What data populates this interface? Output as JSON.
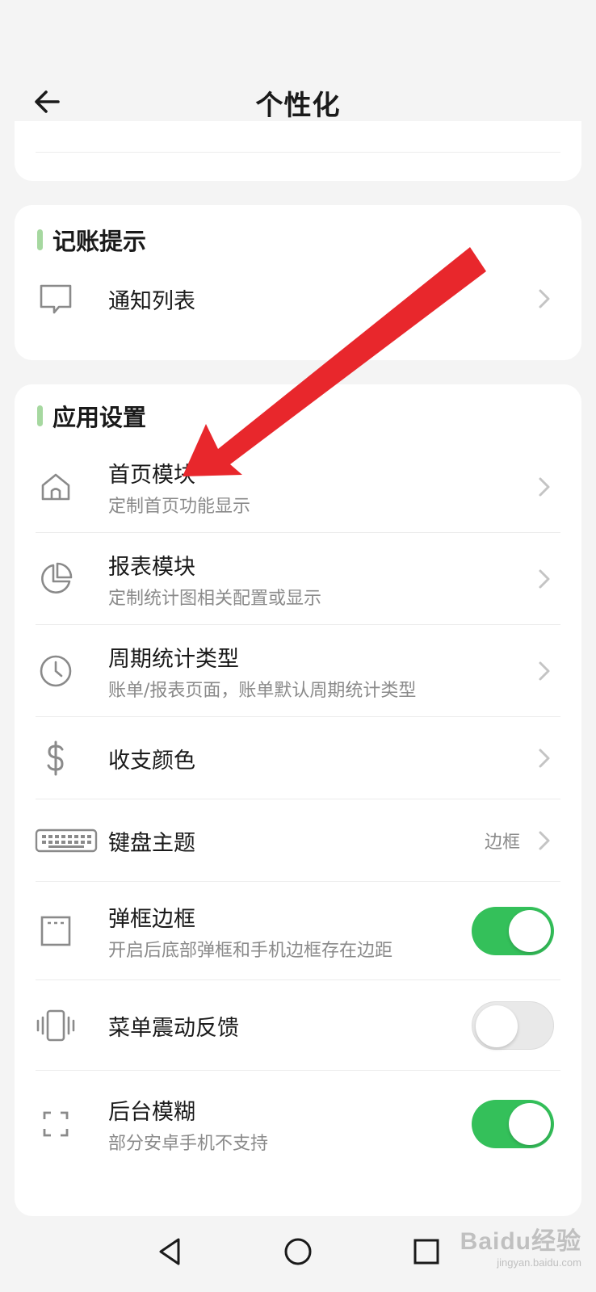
{
  "header": {
    "title": "个性化"
  },
  "sections": {
    "notify": {
      "title": "记账提示",
      "items": [
        {
          "title": "通知列表",
          "icon": "chat-bubble-icon"
        }
      ]
    },
    "app": {
      "title": "应用设置",
      "items": [
        {
          "title": "首页模块",
          "subtitle": "定制首页功能显示",
          "icon": "home-icon"
        },
        {
          "title": "报表模块",
          "subtitle": "定制统计图相关配置或显示",
          "icon": "pie-chart-icon"
        },
        {
          "title": "周期统计类型",
          "subtitle": "账单/报表页面，账单默认周期统计类型",
          "icon": "clock-icon"
        },
        {
          "title": "收支颜色",
          "icon": "dollar-icon"
        },
        {
          "title": "键盘主题",
          "value": "边框",
          "icon": "keyboard-icon"
        },
        {
          "title": "弹框边框",
          "subtitle": "开启后底部弹框和手机边框存在边距",
          "toggle": true,
          "icon": "frame-icon"
        },
        {
          "title": "菜单震动反馈",
          "toggle": false,
          "icon": "vibrate-icon"
        },
        {
          "title": "后台模糊",
          "subtitle": "部分安卓手机不支持",
          "toggle": true,
          "icon": "blur-corners-icon"
        }
      ]
    }
  },
  "watermark": {
    "main": "Baidu经验",
    "sub": "jingyan.baidu.com"
  },
  "colors": {
    "accent": "#34c05a",
    "section_bar": "#a6d8a0",
    "arrow": "#e8272c"
  }
}
